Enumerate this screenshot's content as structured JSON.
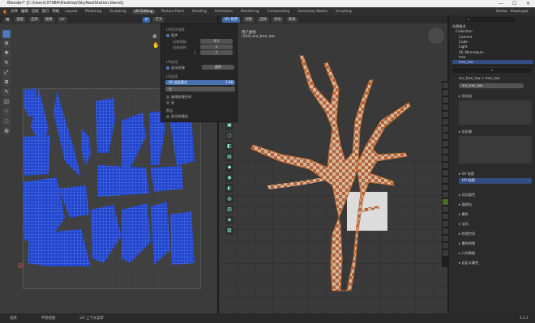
{
  "window": {
    "title": "Blender* [C:\\Users\\37984\\Desktop\\SkyRealStation.blend]",
    "minimize": "—",
    "maximize": "☐",
    "close": "✕"
  },
  "menu": {
    "items": [
      "文件",
      "编辑",
      "渲染",
      "窗口",
      "帮助"
    ],
    "workspaces": [
      "Layout",
      "Modeling",
      "Sculpting",
      "UV Editing",
      "Texture Paint",
      "Shading",
      "Animation",
      "Rendering",
      "Compositing",
      "Geometry Nodes",
      "Scripting"
    ],
    "active_workspace": "UV Editing",
    "scene": "Scene",
    "view_layer": "ViewLayer"
  },
  "uv_header": {
    "mode": "UV 编辑器",
    "view": "视图",
    "select": "选择",
    "image": "图像",
    "uv": "UV",
    "open": "打开"
  },
  "vp_header": {
    "mode": "编辑模式",
    "view": "视图",
    "select": "选择",
    "add": "添加",
    "mesh": "网格",
    "uv_sync": "UV 同步"
  },
  "viewport": {
    "line1": "用户透视",
    "line2": "(319) arv_tree_low"
  },
  "popup": {
    "title": "UV同步选择",
    "sync_label": "同步",
    "f1_label": "拉伸限制",
    "f1_val": "0.1",
    "f2_label": "边缘选择",
    "f2_val": "1",
    "f3_label": "1",
    "f3_val": "1",
    "group2": "UV选项",
    "sticky_label": "显示拉伸",
    "sticky_val": "面积",
    "group3": "UV选项",
    "btn": "UV 选区模式",
    "btn_val": "1.88",
    "dd": "无",
    "opt1": "修改纹理空间",
    "opt2": "无",
    "group4": "覆盖",
    "opt3": "显示纹理边"
  },
  "outliner": {
    "search": "场景集合",
    "rows": [
      "场景集合",
      "Collection",
      "Camera",
      "Cube",
      "Light",
      "SK_Mannequin",
      "tree",
      "tree_low"
    ]
  },
  "props": {
    "breadcrumb": "arv_tree_low > tree_low",
    "object": "arv_tree_low",
    "sections": [
      "顶点组",
      "形态键",
      "UV 贴图",
      "顶点颜色",
      "面朝向",
      "属性",
      "法向",
      "纹理空间",
      "重构网格",
      "几何数据",
      "自定义属性"
    ],
    "uv_map": "UV 贴图"
  },
  "status": {
    "s1": "选择",
    "s2": "平移视图",
    "s3": "UV 上下文菜单",
    "version": "3.2.1"
  }
}
